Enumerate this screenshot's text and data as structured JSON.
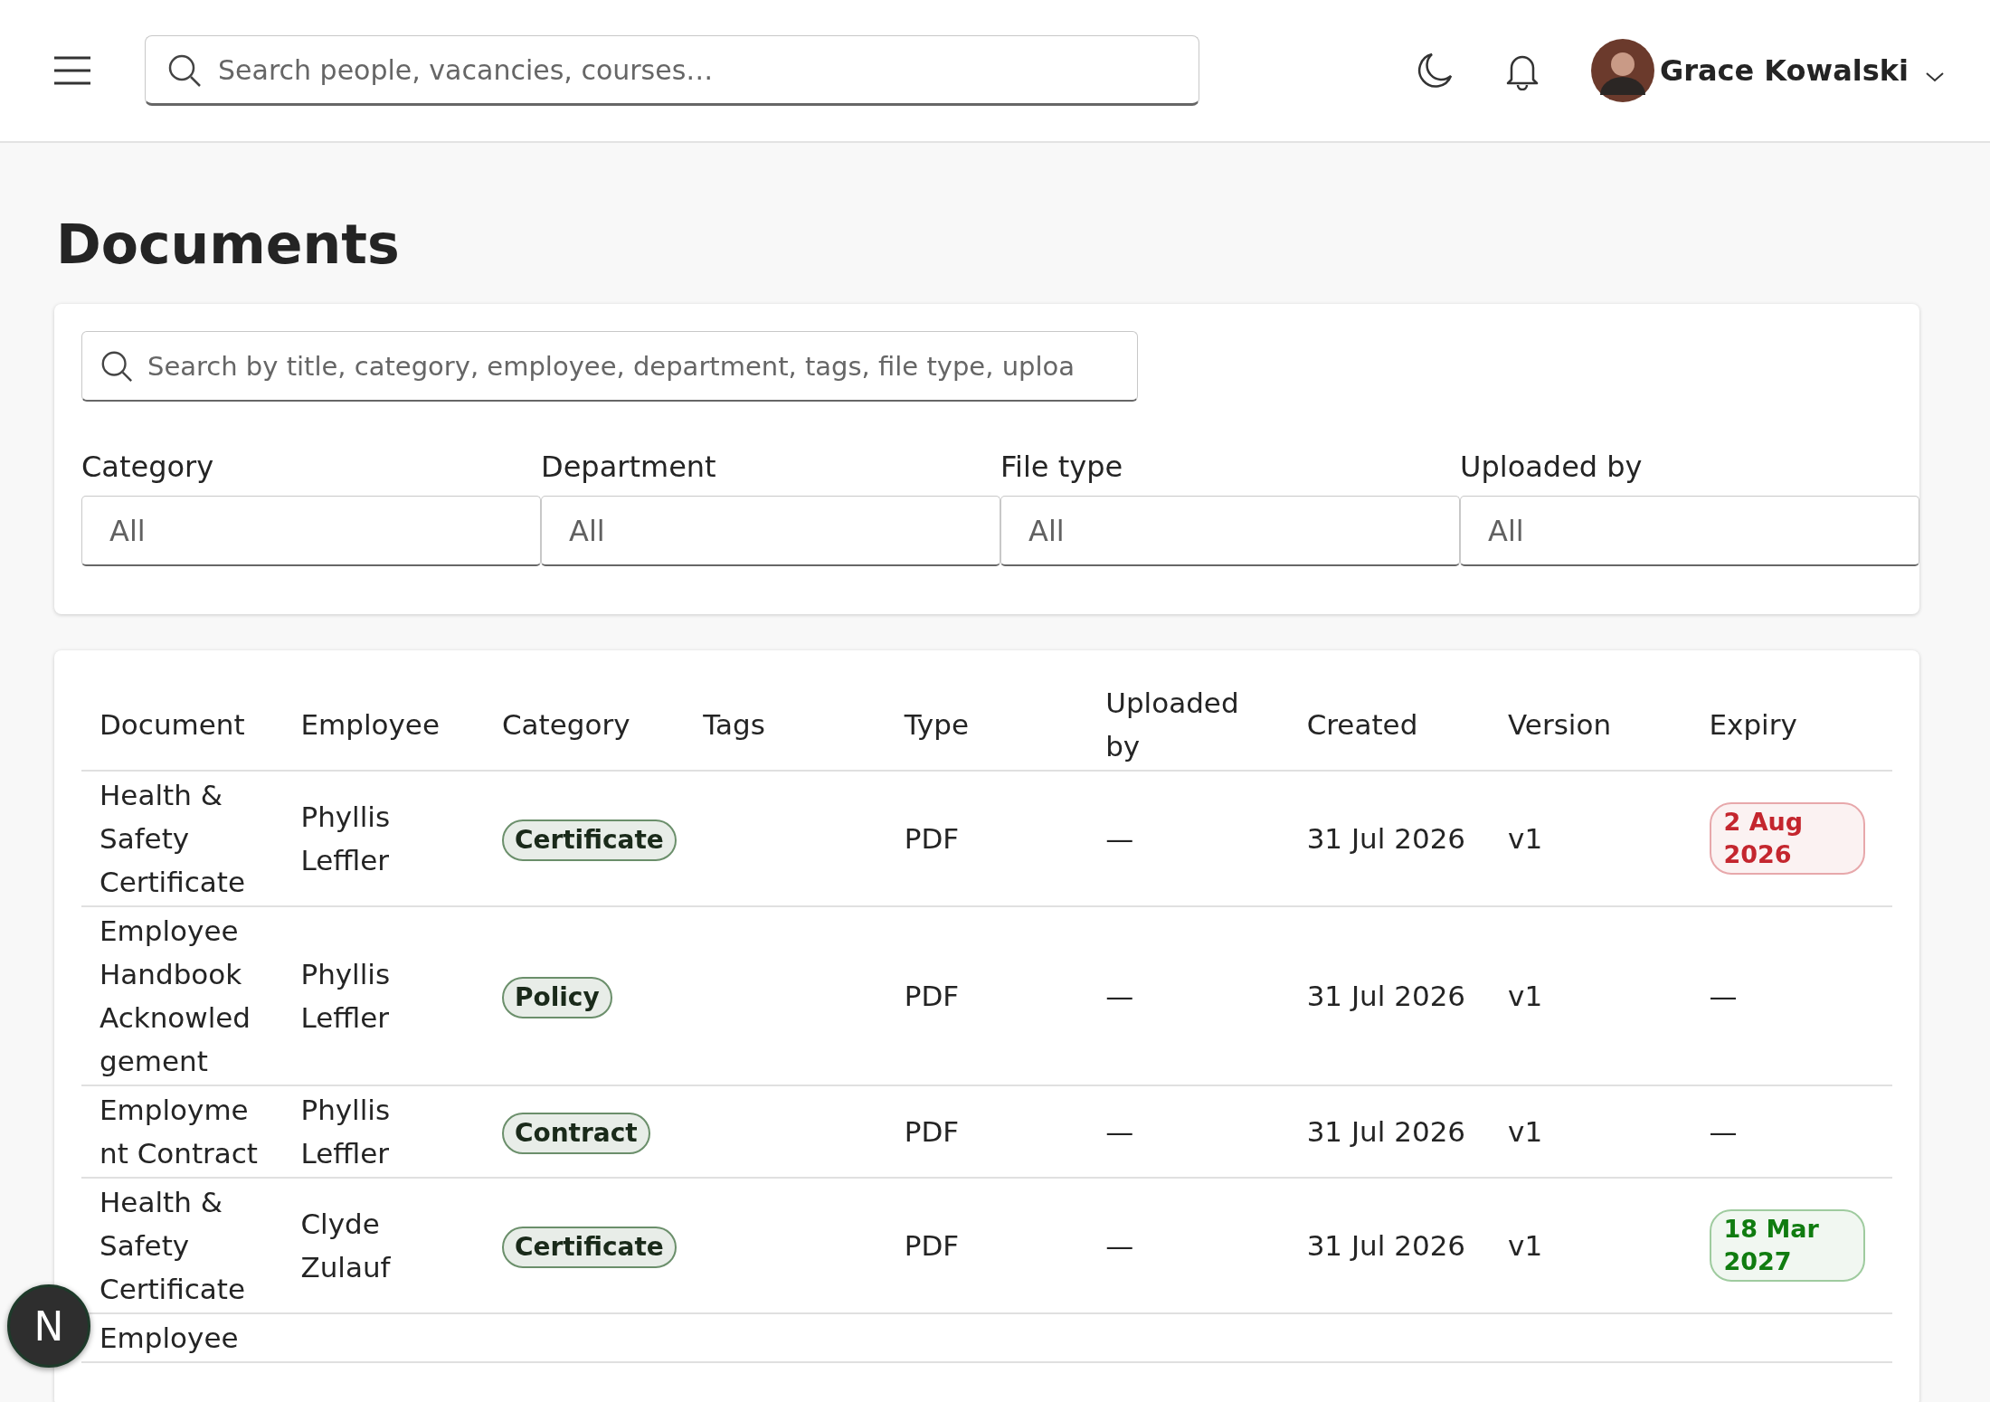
{
  "header": {
    "search": {
      "placeholder": "Search people, vacancies, courses…"
    },
    "user": {
      "name": "Grace Kowalski"
    }
  },
  "page": {
    "title": "Documents"
  },
  "filters": {
    "search": {
      "placeholder": "Search by title, category, employee, department, tags, file type, uploa"
    },
    "selects": [
      {
        "label": "Category",
        "value": "All"
      },
      {
        "label": "Department",
        "value": "All"
      },
      {
        "label": "File type",
        "value": "All"
      },
      {
        "label": "Uploaded by",
        "value": "All"
      }
    ]
  },
  "table": {
    "columns": [
      "Document",
      "Employee",
      "Category",
      "Tags",
      "Type",
      "Uploaded by",
      "Created",
      "Version",
      "Expiry"
    ],
    "rows": [
      {
        "document": "Health & Safety Certificate",
        "employee": "Phyllis Leffler",
        "category": "Certificate",
        "type": "PDF",
        "uploaded_by": "—",
        "created": "31 Jul 2026",
        "version": "v1",
        "expiry": {
          "text": "2 Aug 2026",
          "color": "#c4262e"
        }
      },
      {
        "document": "Employee Handbook Acknowledgement",
        "employee": "Phyllis Leffler",
        "category": "Policy",
        "type": "PDF",
        "uploaded_by": "—",
        "created": "31 Jul 2026",
        "version": "v1",
        "expiry": {
          "text": "—"
        }
      },
      {
        "document": "Employment Contract",
        "employee": "Phyllis Leffler",
        "category": "Contract",
        "type": "PDF",
        "uploaded_by": "—",
        "created": "31 Jul 2026",
        "version": "v1",
        "expiry": {
          "text": "—"
        }
      },
      {
        "document": "Health & Safety Certificate",
        "employee": "Clyde Zulauf",
        "category": "Certificate",
        "type": "PDF",
        "uploaded_by": "—",
        "created": "31 Jul 2026",
        "version": "v1",
        "expiry": {
          "text": "18 Mar 2027",
          "color": "#107c10"
        }
      },
      {
        "document": "Employee"
      }
    ]
  },
  "dev_badge": {
    "text": "N"
  }
}
